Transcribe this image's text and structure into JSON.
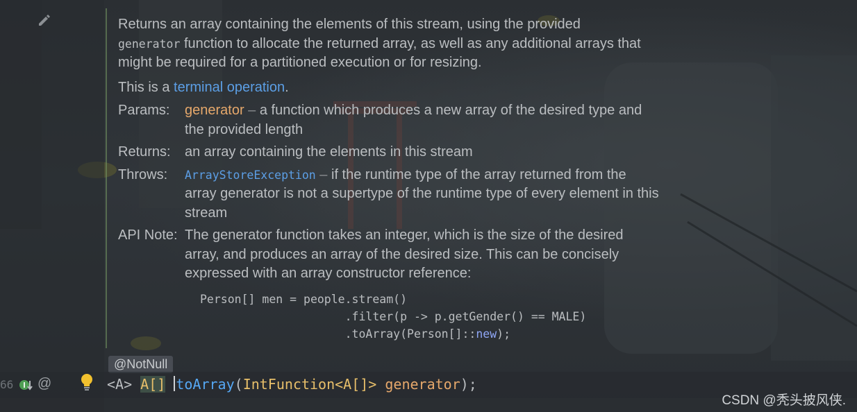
{
  "doc": {
    "description": {
      "part1": "Returns an array containing the elements of this stream, using the provided",
      "code": "generator",
      "part2": " function to allocate the returned array, as well as any additional arrays that might be required for a partitioned execution or for resizing."
    },
    "terminal": {
      "prefix": "This is a ",
      "link": "terminal operation",
      "suffix": "."
    },
    "params": {
      "label": "Params:",
      "name": "generator",
      "dash": " – ",
      "text": "a function which produces a new array of the desired type and the provided length"
    },
    "returns": {
      "label": "Returns:",
      "text": "an array containing the elements in this stream"
    },
    "throws": {
      "label": "Throws:",
      "exception": "ArrayStoreException",
      "dash": " – ",
      "text": "if the runtime type of the array returned from the array generator is not a supertype of the runtime type of every element in this stream"
    },
    "api_note": {
      "label": "API Note:",
      "text": "The generator function takes an integer, which is the size of the desired array, and produces an array of the desired size. This can be concisely expressed with an array constructor reference:"
    },
    "code_example": {
      "line1": "Person[] men = people.stream()",
      "line2": "                     .filter(p -> p.getGender() == MALE)",
      "line3_prefix": "                     .toArray(Person[]::",
      "line3_keyword": "new",
      "line3_suffix": ");"
    }
  },
  "editor": {
    "annotation": "@NotNull",
    "line_number": "66",
    "at_symbol": "@",
    "signature": {
      "generic": "<A> ",
      "return_type": "A[]",
      "space": " ",
      "method": "toArray",
      "open": "(",
      "param_type": "IntFunction<A[]> ",
      "param_name": "generator",
      "close": ");"
    }
  },
  "watermark": "CSDN @秃头披风侠.",
  "icons": {
    "edit": "pencil-icon",
    "implements": "implements-arrow-icon",
    "intention": "lightbulb-icon"
  },
  "colors": {
    "link": "#5c9fe6",
    "param": "#e6a86b",
    "type": "#e8bf6a",
    "method": "#56a8f5",
    "keyword": "#8fa6f5"
  }
}
